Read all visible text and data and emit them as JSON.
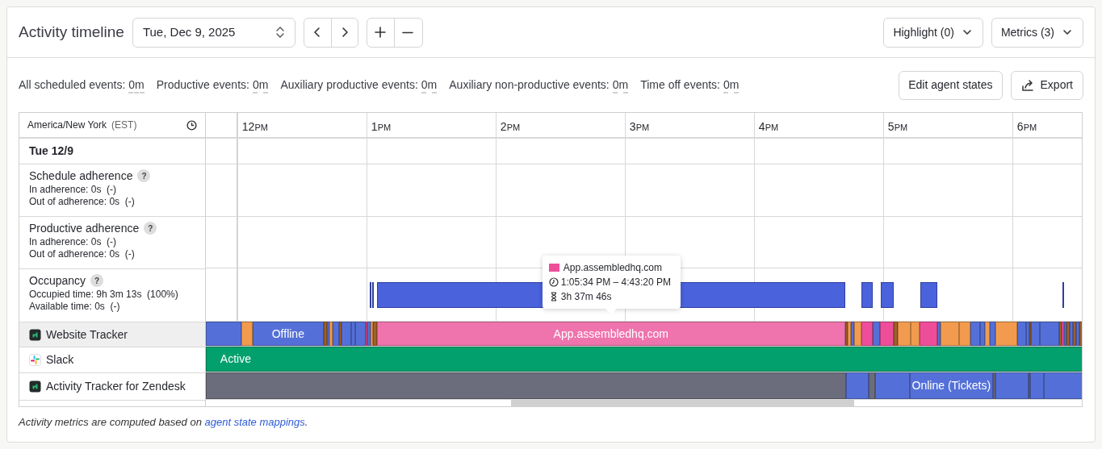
{
  "header": {
    "title": "Activity timeline",
    "date": "Tue, Dec 9, 2025",
    "dropdowns": [
      "Highlight (0)",
      "Metrics (3)"
    ]
  },
  "stats": [
    {
      "label": "All scheduled events:",
      "value": "0m"
    },
    {
      "label": "Productive events:",
      "value": "0m"
    },
    {
      "label": "Auxiliary productive events:",
      "value": "0m"
    },
    {
      "label": "Auxiliary non-productive events:",
      "value": "0m"
    },
    {
      "label": "Time off events:",
      "value": "0m"
    }
  ],
  "actions": {
    "edit": "Edit agent states",
    "export": "Export"
  },
  "timeline": {
    "timezone": "America/New York",
    "tz_abbr": "(EST)",
    "hours": [
      {
        "hour": "12",
        "period": "PM"
      },
      {
        "hour": "1",
        "period": "PM"
      },
      {
        "hour": "2",
        "period": "PM"
      },
      {
        "hour": "3",
        "period": "PM"
      },
      {
        "hour": "4",
        "period": "PM"
      },
      {
        "hour": "5",
        "period": "PM"
      },
      {
        "hour": "6",
        "period": "PM"
      }
    ],
    "day": "Tue 12/9",
    "metrics": [
      {
        "title": "Schedule adherence",
        "help": "?",
        "lines": [
          "In adherence: 0s  (-)",
          "Out of adherence: 0s  (-)"
        ]
      },
      {
        "title": "Productive adherence",
        "help": "?",
        "lines": [
          "In adherence: 0s  (-)",
          "Out of adherence: 0s  (-)"
        ]
      },
      {
        "title": "Occupancy",
        "help": "?",
        "lines": [
          "Occupied time: 9h 3m 13s  (100%)",
          "Available time: 0s  (-)"
        ]
      }
    ],
    "tracks": [
      {
        "name": "Website Tracker",
        "kind": "tracker",
        "selected": true,
        "labels": [
          {
            "text": "Offline",
            "color": "#5470d8"
          },
          {
            "text": "App.assembledhq.com",
            "color": "#ef73ad"
          }
        ]
      },
      {
        "name": "Slack",
        "kind": "slack",
        "selected": false,
        "labels": [
          {
            "text": "Active",
            "color": "#02a06c"
          }
        ]
      },
      {
        "name": "Activity Tracker for Zendesk",
        "kind": "tracker",
        "selected": false,
        "labels": [
          {
            "text": "Online (Tickets)",
            "color": "#5470d8"
          }
        ]
      }
    ],
    "tooltip": {
      "color": "#ee4d9a",
      "title": "App.assembledhq.com",
      "time_range": "1:05:34 PM – 4:43:20 PM",
      "duration": "3h 37m 46s"
    }
  },
  "footer": {
    "text": "Activity metrics are computed based on",
    "link": "agent state mappings",
    "end": "."
  }
}
